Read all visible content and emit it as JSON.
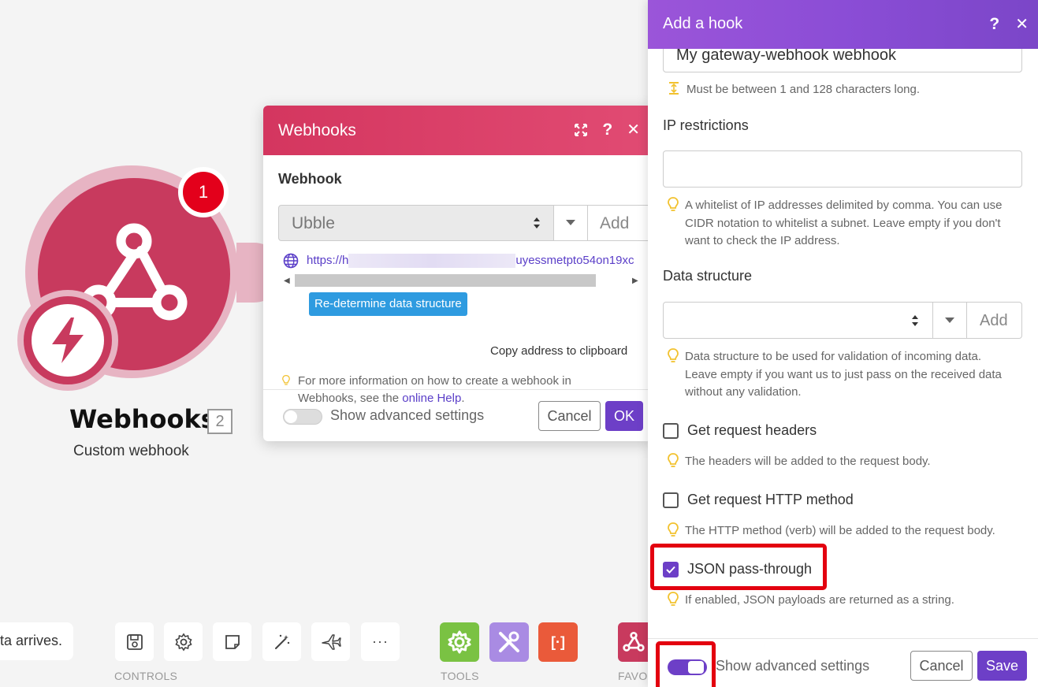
{
  "colors": {
    "webhook_module": "#c83a5e",
    "webhook_header": "#d4365f",
    "hook_header": "#8b4dd6",
    "primary_button": "#6d3fc7",
    "link": "#5a3ec8",
    "highlight": "#e3000f",
    "info_button": "#2e9be0"
  },
  "canvas": {
    "module": {
      "title": "Webhooks",
      "subtitle": "Custom webhook",
      "badge_count": "1",
      "module_number": "2",
      "icon": "webhook-icon",
      "trigger_icon": "lightning-icon"
    }
  },
  "toolbar": {
    "hint_text": "ta arrives.",
    "controls_label": "CONTROLS",
    "tools_label": "TOOLS",
    "favorites_label": "FAVO",
    "controls": [
      {
        "icon": "save-icon"
      },
      {
        "icon": "gear-icon"
      },
      {
        "icon": "note-icon"
      },
      {
        "icon": "magic-wand-icon"
      },
      {
        "icon": "airplane-icon"
      },
      {
        "icon": "more-icon",
        "label": "···"
      }
    ],
    "tools": [
      {
        "icon": "gear-tool-icon"
      },
      {
        "icon": "tools-icon"
      },
      {
        "icon": "json-bracket-icon",
        "label": "[·]"
      }
    ]
  },
  "webhooks_dialog": {
    "title": "Webhooks",
    "field_label": "Webhook",
    "selected_value": "Ubble",
    "add_label": "Add",
    "url_prefix": "https://h",
    "url_suffix": "uyessmetpto54on19xc",
    "redetermine_label": "Re-determine data structure",
    "copy_label": "Copy address to clipboard",
    "info_text": "For more information on how to create a webhook in Webhooks, see the",
    "info_link": "online Help",
    "info_end": ".",
    "advanced_label": "Show advanced settings",
    "cancel_label": "Cancel",
    "ok_label": "OK"
  },
  "hook_panel": {
    "title": "Add a hook",
    "name_value": "My gateway-webhook webhook",
    "name_hint": "Must be between 1 and 128 characters long.",
    "ip_label": "IP restrictions",
    "ip_value": "",
    "ip_hint": "A whitelist of IP addresses delimited by comma. You can use CIDR notation to whitelist a subnet. Leave empty if you don't want to check the IP address.",
    "ds_label": "Data structure",
    "ds_add": "Add",
    "ds_hint": "Data structure to be used for validation of incoming data. Leave empty if you want us to just pass on the received data without any validation.",
    "headers_label": "Get request headers",
    "headers_checked": false,
    "headers_hint": "The headers will be added to the request body.",
    "method_label": "Get request HTTP method",
    "method_checked": false,
    "method_hint": "The HTTP method (verb) will be added to the request body.",
    "json_label": "JSON pass-through",
    "json_checked": true,
    "json_hint": "If enabled, JSON payloads are returned as a string.",
    "advanced_label": "Show advanced settings",
    "advanced_enabled": true,
    "cancel_label": "Cancel",
    "save_label": "Save"
  }
}
